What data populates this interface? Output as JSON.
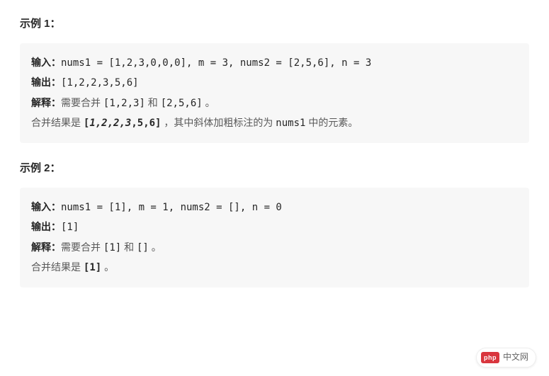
{
  "examples": [
    {
      "heading": "示例 1：",
      "input_label": "输入：",
      "input_code": "nums1 = [1,2,3,0,0,0], m = 3, nums2 = [2,5,6], n = 3",
      "output_label": "输出：",
      "output_code": "[1,2,2,3,5,6]",
      "explain_label": "解释：",
      "explain_prefix": "需要合并 ",
      "explain_code1": "[1,2,3]",
      "explain_mid": " 和 ",
      "explain_code2": "[2,5,6]",
      "explain_suffix": " 。",
      "result_prefix": "合并结果是 ",
      "result_code_open": "[",
      "result_code_bold": "1,2,2,3",
      "result_code_rest": ",5,6]",
      "result_mid": " ，其中斜体加粗标注的为 ",
      "result_code_var": "nums1",
      "result_suffix": " 中的元素。"
    },
    {
      "heading": "示例 2：",
      "input_label": "输入：",
      "input_code": "nums1 = [1], m = 1, nums2 = [], n = 0",
      "output_label": "输出：",
      "output_code": "[1]",
      "explain_label": "解释：",
      "explain_prefix": "需要合并 ",
      "explain_code1": "[1]",
      "explain_mid": " 和 ",
      "explain_code2": "[]",
      "explain_suffix": " 。",
      "result_prefix": "合并结果是 ",
      "result_code_open": "",
      "result_code_bold": "",
      "result_code_rest": "[1]",
      "result_mid": "",
      "result_code_var": "",
      "result_suffix": " 。"
    }
  ],
  "badge": {
    "logo": "php",
    "text": "中文网"
  }
}
